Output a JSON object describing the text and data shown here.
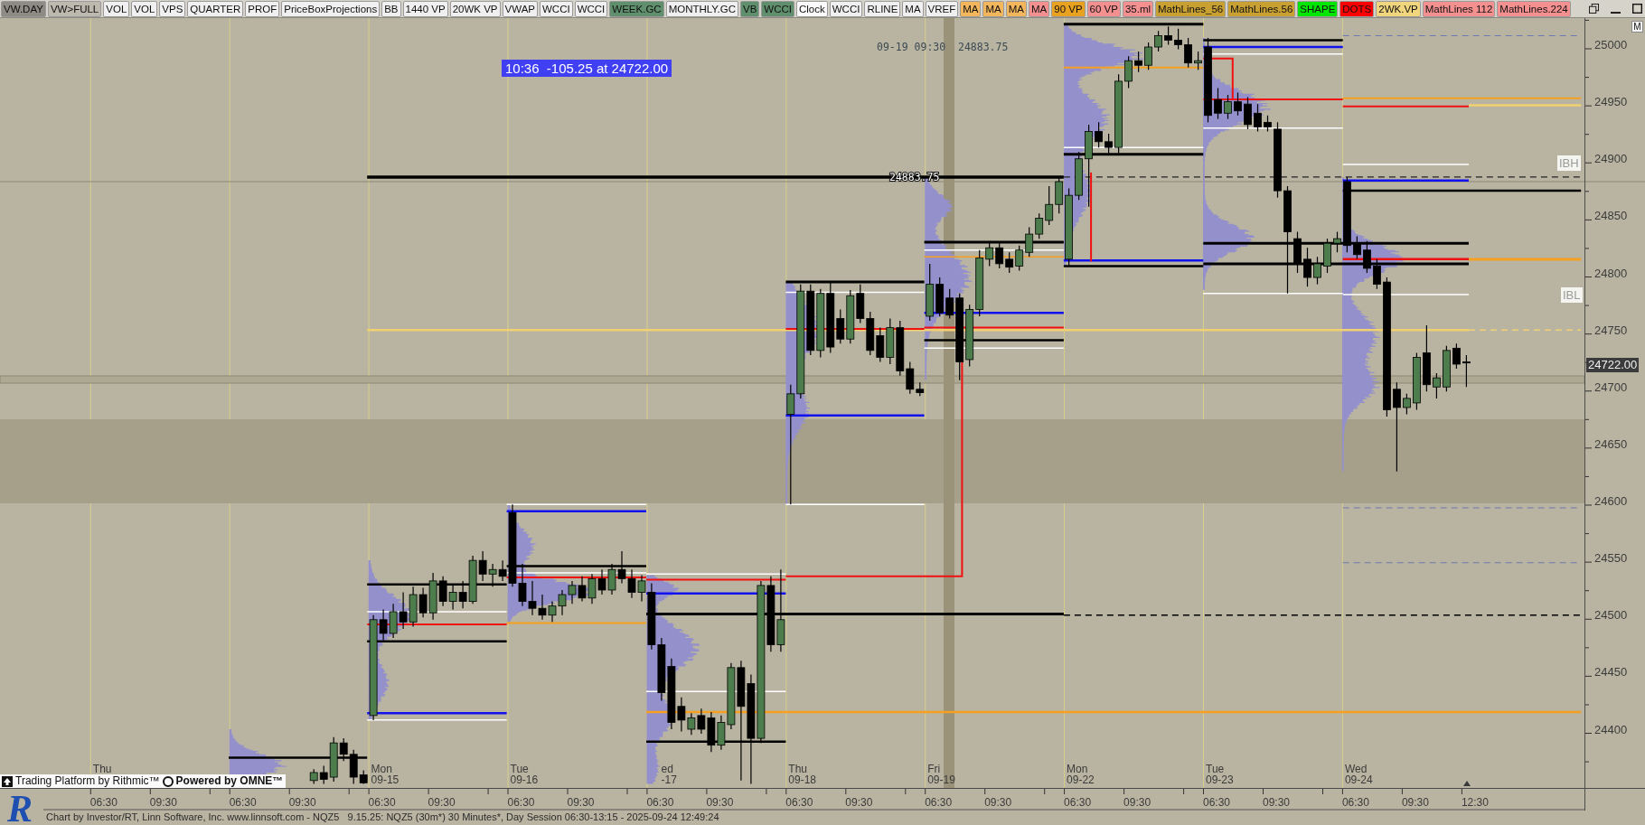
{
  "toolbar": {
    "buttons": [
      {
        "label": "VW.DAY",
        "color": "#8e8a84"
      },
      {
        "label": "VW>FULL",
        "color": "#bdb9ae"
      },
      {
        "label": "VOL",
        "color": "#f0f0f0"
      },
      {
        "label": "VOL",
        "color": "#f0f0f0"
      },
      {
        "label": "VPS",
        "color": "#f0f0f0"
      },
      {
        "label": "QUARTER",
        "color": "#f0f0f0"
      },
      {
        "label": "PROF",
        "color": "#f0f0f0"
      },
      {
        "label": "PriceBoxProjections",
        "color": "#f0f0f0"
      },
      {
        "label": "BB",
        "color": "#f0f0f0"
      },
      {
        "label": "1440 VP",
        "color": "#f0f0f0"
      },
      {
        "label": "20WK VP",
        "color": "#f0f0f0"
      },
      {
        "label": "VWAP",
        "color": "#f0f0f0"
      },
      {
        "label": "WCCI",
        "color": "#f0f0f0"
      },
      {
        "label": "WCCI",
        "color": "#f0f0f0"
      },
      {
        "label": "WEEK.GC",
        "color": "#5f8f6c"
      },
      {
        "label": "MONTHLY.GC",
        "color": "#f0f0f0"
      },
      {
        "label": "VB",
        "color": "#5f8f6c"
      },
      {
        "label": "WCCI",
        "color": "#5f8f6c"
      },
      {
        "label": "Clock",
        "color": "#fafafa"
      },
      {
        "label": "WCCI",
        "color": "#f0f0f0"
      },
      {
        "label": "RLINE",
        "color": "#f0f0f0"
      },
      {
        "label": "MA",
        "color": "#f0f0f0"
      },
      {
        "label": "VREF",
        "color": "#f0f0f0"
      },
      {
        "label": "MA",
        "color": "#f3b65c"
      },
      {
        "label": "MA",
        "color": "#f3b65c"
      },
      {
        "label": "MA",
        "color": "#f3b65c"
      },
      {
        "label": "MA",
        "color": "#f59090"
      },
      {
        "label": "90 VP",
        "color": "#e9a21f"
      },
      {
        "label": "60 VP",
        "color": "#f59090"
      },
      {
        "label": "35.ml",
        "color": "#f59090"
      },
      {
        "label": "MathLines_56",
        "color": "#c9a032"
      },
      {
        "label": "MathLines.56",
        "color": "#c9a032"
      },
      {
        "label": "SHAPE",
        "color": "#00e600"
      },
      {
        "label": "DOTS",
        "color": "#ff0000"
      },
      {
        "label": "2WK.VP",
        "color": "#f2d67e"
      },
      {
        "label": "MathLines 112",
        "color": "#f59090"
      },
      {
        "label": "MathLines.224",
        "color": "#f59090"
      }
    ]
  },
  "chart": {
    "annotations": [
      {
        "kind": "box",
        "text": "10:36  -105.25 at 24722.00"
      },
      {
        "kind": "note",
        "text": "09-19 09:30  24883.75"
      },
      {
        "kind": "line_price",
        "text": "24883.75"
      }
    ],
    "level_tags": [
      "IBH",
      "IBL"
    ],
    "sessions": [
      {
        "day": "Thu",
        "times": [
          "06:30",
          "09:30"
        ]
      },
      {
        "times": [
          "06:30",
          "09:30"
        ]
      },
      {
        "day": "Mon",
        "date": "09-15",
        "times": [
          "06:30",
          "09:30"
        ]
      },
      {
        "day": "Tue",
        "date": "09-16",
        "times": [
          "06:30",
          "09:30"
        ]
      },
      {
        "day": "ed",
        "date": "-17",
        "times": [
          "06:30",
          "09:30"
        ]
      },
      {
        "day": "Thu",
        "date": "09-18",
        "times": [
          "06:30",
          "09:30"
        ]
      },
      {
        "day": "Fri",
        "date": "09-19",
        "times": [
          "06:30",
          "09:30"
        ]
      },
      {
        "day": "Mon",
        "date": "09-22",
        "times": [
          "06:30",
          "09:30"
        ]
      },
      {
        "day": "Tue",
        "date": "09-23",
        "times": [
          "06:30",
          "09:30"
        ]
      },
      {
        "day": "Wed",
        "date": "09-24",
        "times": [
          "06:30",
          "09:30",
          "12:30"
        ]
      }
    ]
  },
  "price_axis": {
    "mode_button": "M",
    "ticks": [
      "25000",
      "24950",
      "24900",
      "24850",
      "24800",
      "24750",
      "24700",
      "24650",
      "24600",
      "24550",
      "24500",
      "24450",
      "24400"
    ],
    "current_price": "24722.00"
  },
  "credits": {
    "platform": "Trading Platform by Rithmic™",
    "powered_by": "Powered by OMNE™"
  },
  "footer": {
    "logo": "R",
    "text": "Chart by Investor/RT, Linn Software, Inc. www.linnsoft.com - NQZ5   9.15.25: NQZ5 (30m*) 30 Minutes*, Day Session 06:30-13:15 - 2025-09-24 12:49:24"
  }
}
